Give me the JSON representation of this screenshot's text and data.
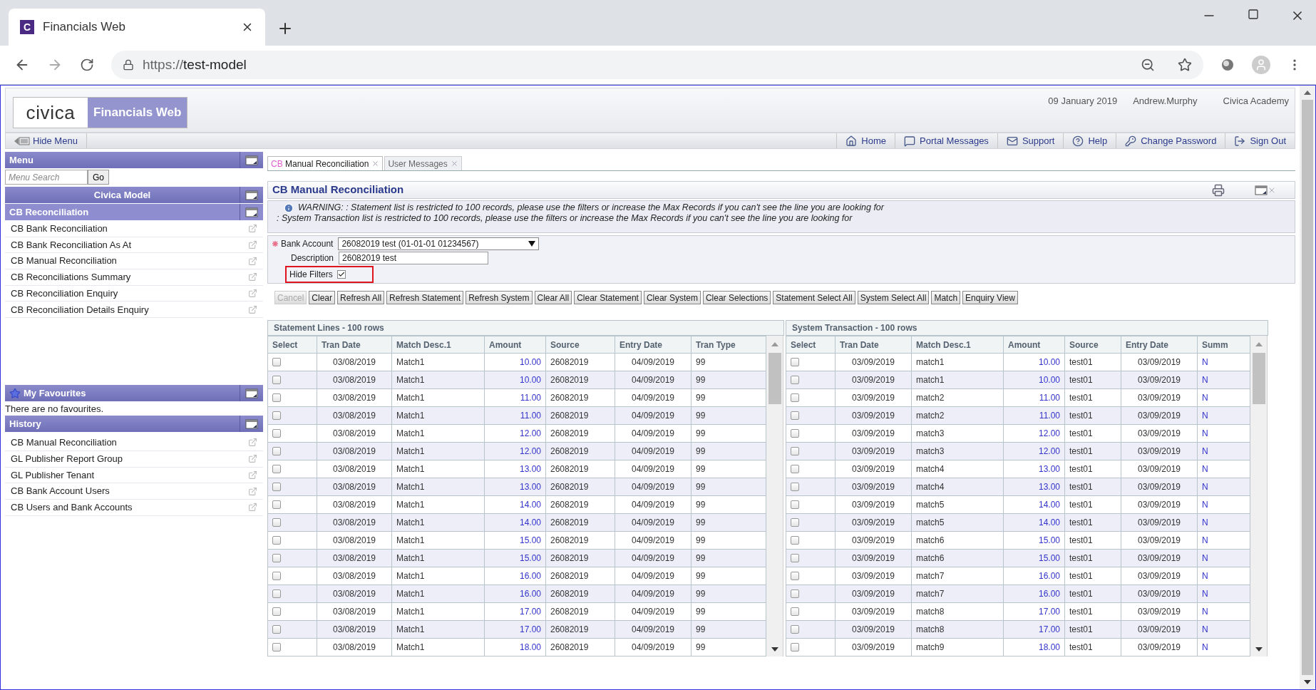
{
  "browser": {
    "tab_title": "Financials Web",
    "favicon": "C",
    "url_scheme": "https://",
    "url_host": "test-model"
  },
  "header": {
    "logo": "civica",
    "product": "Financials Web",
    "date": "09 January 2019",
    "user": "Andrew.Murphy",
    "org": "Civica Academy"
  },
  "toolbar": {
    "hide_menu": "Hide Menu",
    "links": [
      {
        "kind": "home",
        "label": "Home"
      },
      {
        "kind": "messages",
        "label": "Portal Messages"
      },
      {
        "kind": "support",
        "label": "Support"
      },
      {
        "kind": "help",
        "label": "Help"
      },
      {
        "kind": "password",
        "label": "Change Password"
      },
      {
        "kind": "signout",
        "label": "Sign Out"
      }
    ]
  },
  "sidebar": {
    "menu_title": "Menu",
    "search_placeholder": "Menu Search",
    "go": "Go",
    "model": "Civica Model",
    "section": "CB Reconciliation",
    "items": [
      "CB Bank Reconciliation",
      "CB Bank Reconciliation As At",
      "CB Manual Reconciliation",
      "CB Reconciliations Summary",
      "CB Reconciliation Enquiry",
      "CB Reconciliation Details Enquiry"
    ],
    "favourites_title": "My Favourites",
    "favourites_empty": "There are no favourites.",
    "history_title": "History",
    "history": [
      "CB Manual Reconciliation",
      "GL Publisher Report Group",
      "GL Publisher Tenant",
      "CB Bank Account Users",
      "CB Users and Bank Accounts"
    ]
  },
  "tabs": [
    {
      "prefix": "CB",
      "label": "Manual Reconciliation",
      "selected": true
    },
    {
      "label": "User Messages",
      "selected": false
    }
  ],
  "panel": {
    "title": "CB Manual Reconciliation",
    "warnings": [
      "WARNING: : Statement list is restricted to 100 records, please use the filters or increase the Max Records if you can't see the line you are looking for",
      ": System Transaction list is restricted to 100 records, please use the filters or increase the Max Records if you can't see the line you are looking for"
    ],
    "bank_account_label": "Bank Account",
    "bank_account": "26082019 test (01-01-01 01234567)",
    "description_label": "Description",
    "description": "26082019 test",
    "hide_filters_label": "Hide Filters",
    "hide_filters": true,
    "hide_filters_highlighted": true,
    "buttons": [
      {
        "label": "Cancel",
        "disabled": true
      },
      {
        "label": "Clear",
        "disabled": false
      },
      {
        "label": "Refresh All",
        "disabled": false
      },
      {
        "label": "Refresh Statement",
        "disabled": false
      },
      {
        "label": "Refresh System",
        "disabled": false
      },
      {
        "label": "Clear All",
        "disabled": false
      },
      {
        "label": "Clear Statement",
        "disabled": false
      },
      {
        "label": "Clear System",
        "disabled": false
      },
      {
        "label": "Clear Selections",
        "disabled": false
      },
      {
        "label": "Statement Select All",
        "disabled": false
      },
      {
        "label": "System Select All",
        "disabled": false
      },
      {
        "label": "Match",
        "disabled": false
      },
      {
        "label": "Enquiry View",
        "disabled": false
      }
    ]
  },
  "tables": [
    {
      "title": "Statement Lines - 100 rows",
      "select_header": "Select",
      "columns": [
        "Tran Date",
        "Match Desc.1",
        "Amount",
        "Source",
        "Entry Date",
        "Tran Type"
      ],
      "rows": [
        {
          "selected": false,
          "cells": [
            "03/08/2019",
            "Match1",
            "10.00",
            "26082019",
            "04/09/2019",
            "99"
          ]
        },
        {
          "selected": false,
          "cells": [
            "03/08/2019",
            "Match1",
            "10.00",
            "26082019",
            "04/09/2019",
            "99"
          ]
        },
        {
          "selected": false,
          "cells": [
            "03/08/2019",
            "Match1",
            "11.00",
            "26082019",
            "04/09/2019",
            "99"
          ]
        },
        {
          "selected": false,
          "cells": [
            "03/08/2019",
            "Match1",
            "11.00",
            "26082019",
            "04/09/2019",
            "99"
          ]
        },
        {
          "selected": false,
          "cells": [
            "03/08/2019",
            "Match1",
            "12.00",
            "26082019",
            "04/09/2019",
            "99"
          ]
        },
        {
          "selected": false,
          "cells": [
            "03/08/2019",
            "Match1",
            "12.00",
            "26082019",
            "04/09/2019",
            "99"
          ]
        },
        {
          "selected": false,
          "cells": [
            "03/08/2019",
            "Match1",
            "13.00",
            "26082019",
            "04/09/2019",
            "99"
          ]
        },
        {
          "selected": false,
          "cells": [
            "03/08/2019",
            "Match1",
            "13.00",
            "26082019",
            "04/09/2019",
            "99"
          ]
        },
        {
          "selected": false,
          "cells": [
            "03/08/2019",
            "Match1",
            "14.00",
            "26082019",
            "04/09/2019",
            "99"
          ]
        },
        {
          "selected": false,
          "cells": [
            "03/08/2019",
            "Match1",
            "14.00",
            "26082019",
            "04/09/2019",
            "99"
          ]
        },
        {
          "selected": false,
          "cells": [
            "03/08/2019",
            "Match1",
            "15.00",
            "26082019",
            "04/09/2019",
            "99"
          ]
        },
        {
          "selected": false,
          "cells": [
            "03/08/2019",
            "Match1",
            "15.00",
            "26082019",
            "04/09/2019",
            "99"
          ]
        },
        {
          "selected": false,
          "cells": [
            "03/08/2019",
            "Match1",
            "16.00",
            "26082019",
            "04/09/2019",
            "99"
          ]
        },
        {
          "selected": false,
          "cells": [
            "03/08/2019",
            "Match1",
            "16.00",
            "26082019",
            "04/09/2019",
            "99"
          ]
        },
        {
          "selected": false,
          "cells": [
            "03/08/2019",
            "Match1",
            "17.00",
            "26082019",
            "04/09/2019",
            "99"
          ]
        },
        {
          "selected": false,
          "cells": [
            "03/08/2019",
            "Match1",
            "17.00",
            "26082019",
            "04/09/2019",
            "99"
          ]
        },
        {
          "selected": false,
          "cells": [
            "03/08/2019",
            "Match1",
            "18.00",
            "26082019",
            "04/09/2019",
            "99"
          ]
        }
      ]
    },
    {
      "title": "System Transaction - 100 rows",
      "select_header": "Select",
      "columns": [
        "Tran Date",
        "Match Desc.1",
        "Amount",
        "Source",
        "Entry Date",
        "Summ"
      ],
      "rows": [
        {
          "selected": false,
          "cells": [
            "03/09/2019",
            "match1",
            "10.00",
            "test01",
            "03/09/2019",
            "N"
          ]
        },
        {
          "selected": false,
          "cells": [
            "03/09/2019",
            "match1",
            "10.00",
            "test01",
            "03/09/2019",
            "N"
          ]
        },
        {
          "selected": false,
          "cells": [
            "03/09/2019",
            "match2",
            "11.00",
            "test01",
            "03/09/2019",
            "N"
          ]
        },
        {
          "selected": false,
          "cells": [
            "03/09/2019",
            "match2",
            "11.00",
            "test01",
            "03/09/2019",
            "N"
          ]
        },
        {
          "selected": false,
          "cells": [
            "03/09/2019",
            "match3",
            "12.00",
            "test01",
            "03/09/2019",
            "N"
          ]
        },
        {
          "selected": false,
          "cells": [
            "03/09/2019",
            "match3",
            "12.00",
            "test01",
            "03/09/2019",
            "N"
          ]
        },
        {
          "selected": false,
          "cells": [
            "03/09/2019",
            "match4",
            "13.00",
            "test01",
            "03/09/2019",
            "N"
          ]
        },
        {
          "selected": false,
          "cells": [
            "03/09/2019",
            "match4",
            "13.00",
            "test01",
            "03/09/2019",
            "N"
          ]
        },
        {
          "selected": false,
          "cells": [
            "03/09/2019",
            "match5",
            "14.00",
            "test01",
            "03/09/2019",
            "N"
          ]
        },
        {
          "selected": false,
          "cells": [
            "03/09/2019",
            "match5",
            "14.00",
            "test01",
            "03/09/2019",
            "N"
          ]
        },
        {
          "selected": false,
          "cells": [
            "03/09/2019",
            "match6",
            "15.00",
            "test01",
            "03/09/2019",
            "N"
          ]
        },
        {
          "selected": false,
          "cells": [
            "03/09/2019",
            "match6",
            "15.00",
            "test01",
            "03/09/2019",
            "N"
          ]
        },
        {
          "selected": false,
          "cells": [
            "03/09/2019",
            "match7",
            "16.00",
            "test01",
            "03/09/2019",
            "N"
          ]
        },
        {
          "selected": false,
          "cells": [
            "03/09/2019",
            "match7",
            "16.00",
            "test01",
            "03/09/2019",
            "N"
          ]
        },
        {
          "selected": false,
          "cells": [
            "03/09/2019",
            "match8",
            "17.00",
            "test01",
            "03/09/2019",
            "N"
          ]
        },
        {
          "selected": false,
          "cells": [
            "03/09/2019",
            "match8",
            "17.00",
            "test01",
            "03/09/2019",
            "N"
          ]
        },
        {
          "selected": false,
          "cells": [
            "03/09/2019",
            "match9",
            "18.00",
            "test01",
            "03/09/2019",
            "N"
          ]
        }
      ]
    }
  ]
}
